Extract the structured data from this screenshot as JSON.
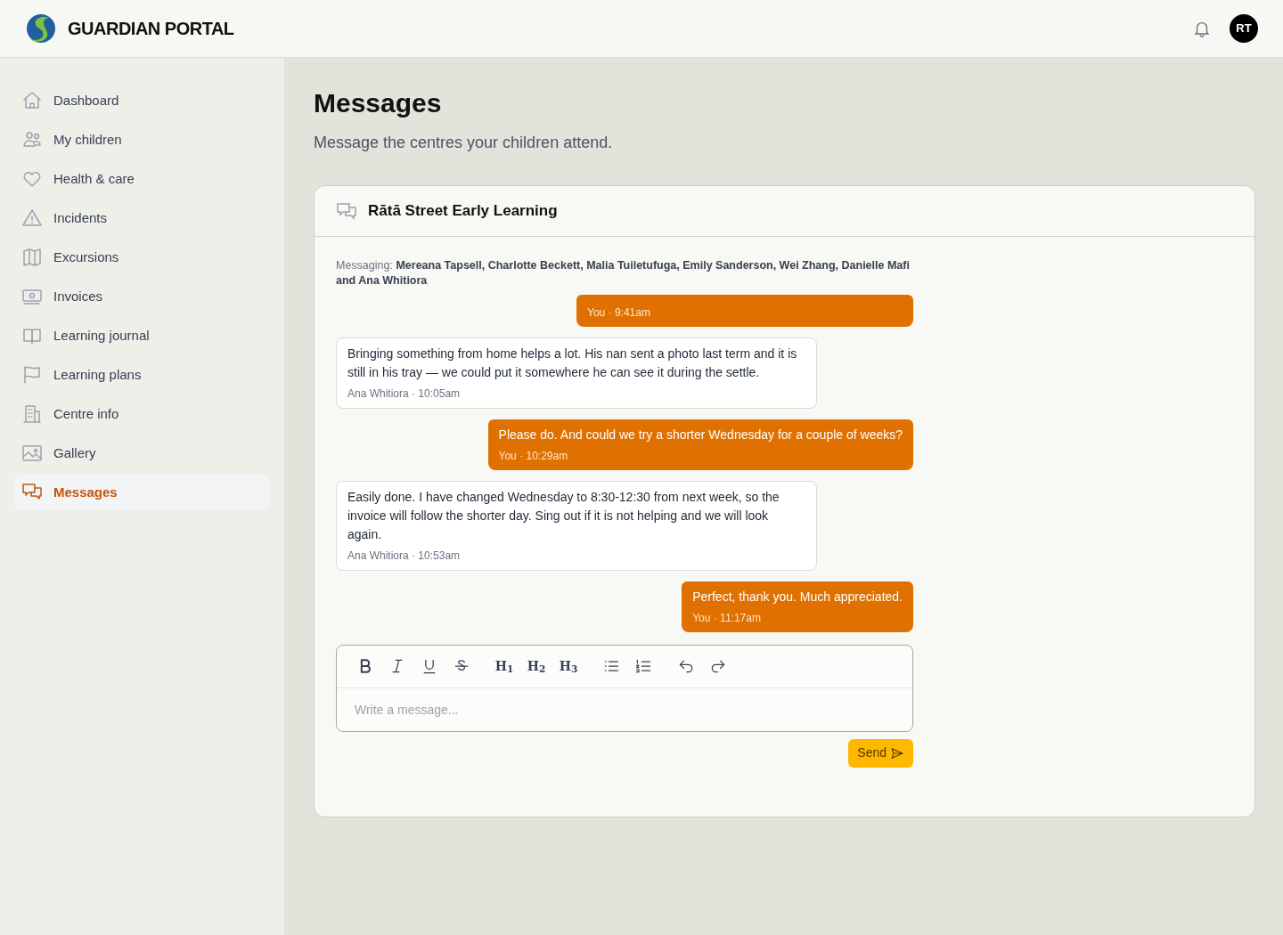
{
  "brand": {
    "name": "GUARDIAN PORTAL"
  },
  "header": {
    "avatar": "RT"
  },
  "sidebar": {
    "items": [
      {
        "label": "Dashboard",
        "selected": false
      },
      {
        "label": "My children",
        "selected": false
      },
      {
        "label": "Health & care",
        "selected": false
      },
      {
        "label": "Incidents",
        "selected": false
      },
      {
        "label": "Excursions",
        "selected": false
      },
      {
        "label": "Invoices",
        "selected": false
      },
      {
        "label": "Learning journal",
        "selected": false
      },
      {
        "label": "Learning plans",
        "selected": false
      },
      {
        "label": "Centre info",
        "selected": false
      },
      {
        "label": "Gallery",
        "selected": false
      },
      {
        "label": "Messages",
        "selected": true
      }
    ]
  },
  "page": {
    "title": "Messages",
    "subtitle": "Message the centres your children attend."
  },
  "conversation": {
    "title": "Rātā Street Early Learning",
    "recipients_label": "Messaging:",
    "recipients": "Mereana Tapsell, Charlotte Beckett, Malia Tuiletufuga, Emily Sanderson, Wei Zhang, Danielle Mafi and Ana Whitiora",
    "messages": [
      {
        "from_me": true,
        "meta": "You · 9:41am"
      },
      {
        "from_me": false,
        "text": "Bringing something from home helps a lot. His nan sent a photo last term and it is still in his tray — we could put it somewhere he can see it during the settle.",
        "meta": "Ana Whitiora · 10:05am"
      },
      {
        "from_me": true,
        "text": "Please do. And could we try a shorter Wednesday for a couple of weeks?",
        "meta": "You · 10:29am"
      },
      {
        "from_me": false,
        "text": "Easily done. I have changed Wednesday to 8:30-12:30 from next week, so the invoice will follow the shorter day. Sing out if it is not helping and we will look again.",
        "meta": "Ana Whitiora · 10:53am"
      },
      {
        "from_me": true,
        "text": "Perfect, thank you. Much appreciated.",
        "meta": "You · 11:17am"
      }
    ],
    "toolbar": [
      {
        "kind": "icon"
      },
      {
        "kind": "icon"
      },
      {
        "kind": "icon"
      },
      {
        "kind": "icon"
      },
      {
        "kind": "heading",
        "label": "H$_{1}$"
      },
      {
        "kind": "heading",
        "label": "H$_{2}$"
      },
      {
        "kind": "heading",
        "label": "H$_{3}$"
      },
      {
        "kind": "icon"
      },
      {
        "kind": "icon"
      },
      {
        "kind": "icon"
      },
      {
        "kind": "icon"
      }
    ],
    "composer": {
      "placeholder": "Write a message..."
    },
    "send_button": "Send"
  }
}
